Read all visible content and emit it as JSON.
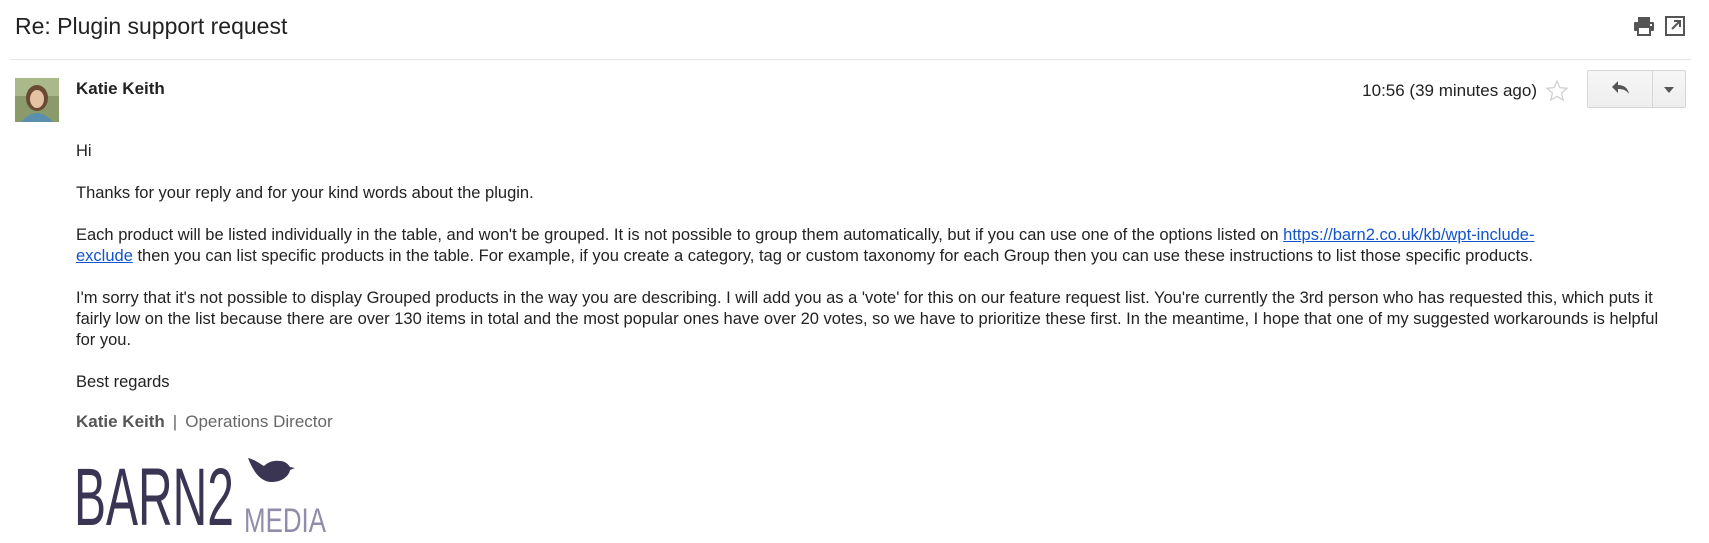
{
  "email": {
    "subject": "Re: Plugin support request",
    "sender": "Katie Keith",
    "time": "10:56 (39 minutes ago)"
  },
  "body": {
    "greeting": "Hi",
    "p1": "Thanks for your reply and for your kind words about the plugin.",
    "p2_before": "Each product will be listed individually in the table, and won't be grouped. It is not possible to group them automatically, but if you can use one of the options listed on ",
    "p2_link_line1": "https://barn2.co.uk/kb/wpt-include-",
    "p2_link_line2": "exclude",
    "p2_after": " then you can list specific products in the table. For example, if you create a category, tag or custom taxonomy for each Group then you can use these instructions to list those specific products.",
    "p3": "I'm sorry that it's not possible to display Grouped products in the way you are describing. I will add you as a 'vote' for this on our feature request list. You're currently the 3rd person who has requested this, which puts it fairly low on the list because there are over 130 items in total and the most popular ones have over 20 votes, so we have to prioritize these first. In the meantime, I hope that one of my suggested workarounds is helpful for you.",
    "closing": "Best regards"
  },
  "signature": {
    "name": "Katie Keith",
    "separator": "|",
    "title": "Operations Director",
    "logo_text_main": "BARN2",
    "logo_text_sub": "MEDIA"
  },
  "icons": {
    "print": "print-icon",
    "popout": "open-in-new-window-icon",
    "star": "star-icon",
    "reply": "reply-icon",
    "more": "dropdown-arrow-icon"
  },
  "colors": {
    "link": "#1155cc",
    "logo": "#3a3553"
  }
}
